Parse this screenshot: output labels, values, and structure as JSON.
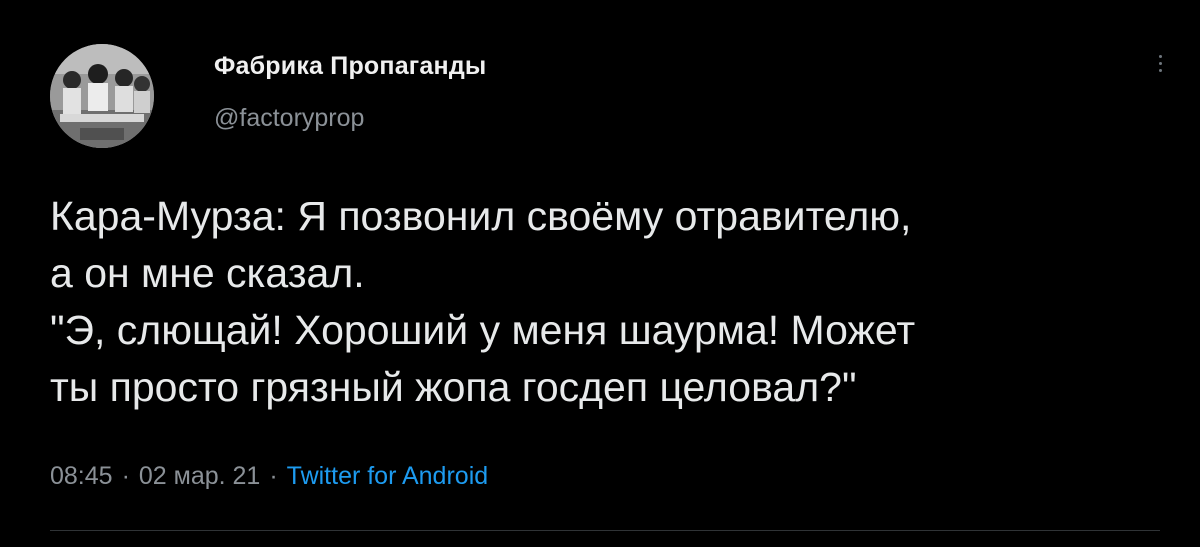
{
  "tweet": {
    "author": {
      "display_name": "Фабрика Пропаганды",
      "handle": "@factoryprop",
      "avatar_icon": "vintage-photo-avatar"
    },
    "more_icon": "more-vertical-icon",
    "text_lines": [
      "Кара-Мурза: Я позвонил своёму отравителю,",
      "а он мне сказал.",
      "\"Э, слющай! Хороший у меня шаурма! Может",
      "ты просто грязный жопа госдеп целовал?\""
    ],
    "time": "08:45",
    "date": "02 мар. 21",
    "separator": "·",
    "source": "Twitter for Android"
  },
  "colors": {
    "background": "#000000",
    "text_primary": "#e7e9ea",
    "text_secondary": "#8b9197",
    "link": "#1d9bf0",
    "divider": "#2f3336"
  }
}
